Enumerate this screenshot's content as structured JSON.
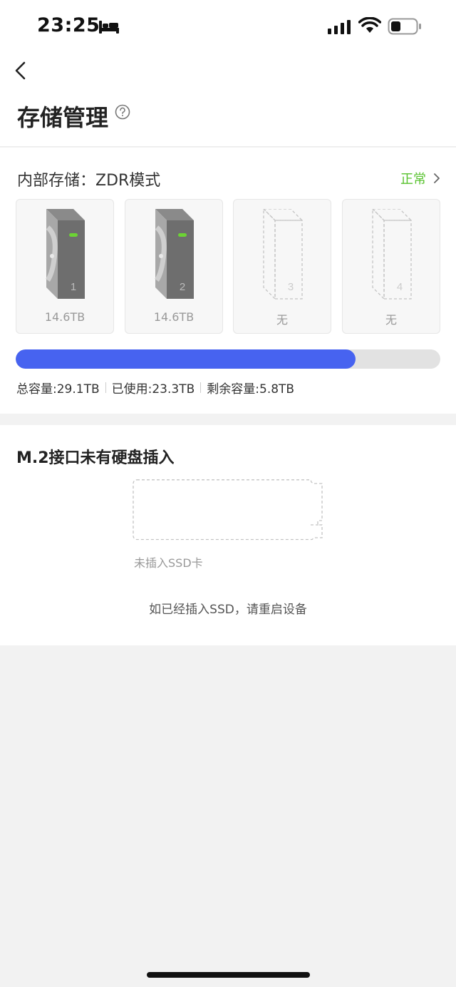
{
  "status_bar": {
    "time": "23:25",
    "icons": [
      "sleep-bed-icon",
      "cellular-signal-icon",
      "wifi-icon",
      "battery-icon"
    ]
  },
  "header": {
    "title": "存储管理",
    "help_icon": "question-circle-icon",
    "back_icon": "chevron-left-icon"
  },
  "internal_storage": {
    "title": "内部存储：ZDR模式",
    "status": "正常",
    "status_color": "#57c22d",
    "disks": [
      {
        "slot": "1",
        "capacity": "14.6TB",
        "installed": true
      },
      {
        "slot": "2",
        "capacity": "14.6TB",
        "installed": true
      },
      {
        "slot": "3",
        "capacity": "无",
        "installed": false
      },
      {
        "slot": "4",
        "capacity": "无",
        "installed": false
      }
    ],
    "usage_fraction": 0.8,
    "bar_color": "#4763f0",
    "total": "总容量:29.1TB",
    "used": "已使用:23.3TB",
    "remaining": "剩余容量:5.8TB"
  },
  "m2": {
    "title": "M.2接口未有硬盘插入",
    "ssd_caption": "未插入SSD卡",
    "hint": "如已经插入SSD，请重启设备"
  }
}
